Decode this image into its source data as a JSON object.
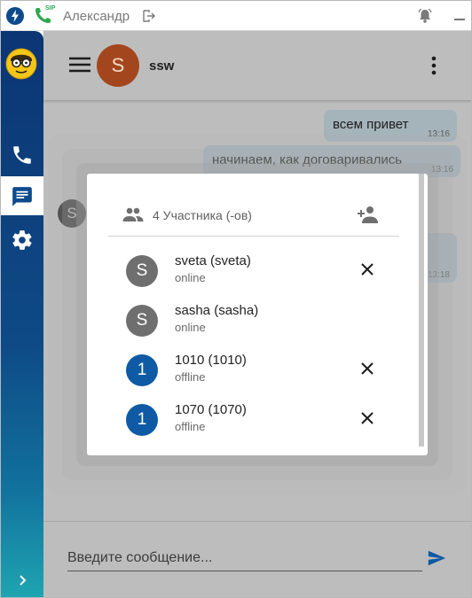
{
  "topbar": {
    "user_name": "Александр",
    "sip_badge": "SIP"
  },
  "sidebar": {
    "items": [
      {
        "name": "calls",
        "icon": "phone-icon"
      },
      {
        "name": "chats",
        "icon": "chat-icon",
        "active": true
      },
      {
        "name": "settings",
        "icon": "gear-icon"
      }
    ]
  },
  "chat": {
    "avatar_letter": "S",
    "title": "ssw",
    "avatar_color": "#a4461d"
  },
  "messages": [
    {
      "text": "всем привет",
      "time": "13:16"
    },
    {
      "text": "начинаем, как договаривались",
      "time": "13:16"
    },
    {
      "time": "13:18"
    }
  ],
  "sender_avatar_letter": "S",
  "composer": {
    "placeholder": "Введите сообщение..."
  },
  "dialog": {
    "participants_count": "4 Участника (-ов)",
    "participants": [
      {
        "letter": "S",
        "name": "sveta (sveta)",
        "status": "online",
        "removable": true,
        "avatar": "grey"
      },
      {
        "letter": "S",
        "name": "sasha (sasha)",
        "status": "online",
        "removable": false,
        "avatar": "grey"
      },
      {
        "letter": "1",
        "name": "1010 (1010)",
        "status": "offline",
        "removable": true,
        "avatar": "blue"
      },
      {
        "letter": "1",
        "name": "1070 (1070)",
        "status": "offline",
        "removable": true,
        "avatar": "blue"
      }
    ]
  },
  "colors": {
    "sidebar_top": "#0c3574",
    "sidebar_bottom": "#1fa5b0",
    "accent_blue": "#0e5aa4",
    "bubble": "#a5b3ba"
  }
}
